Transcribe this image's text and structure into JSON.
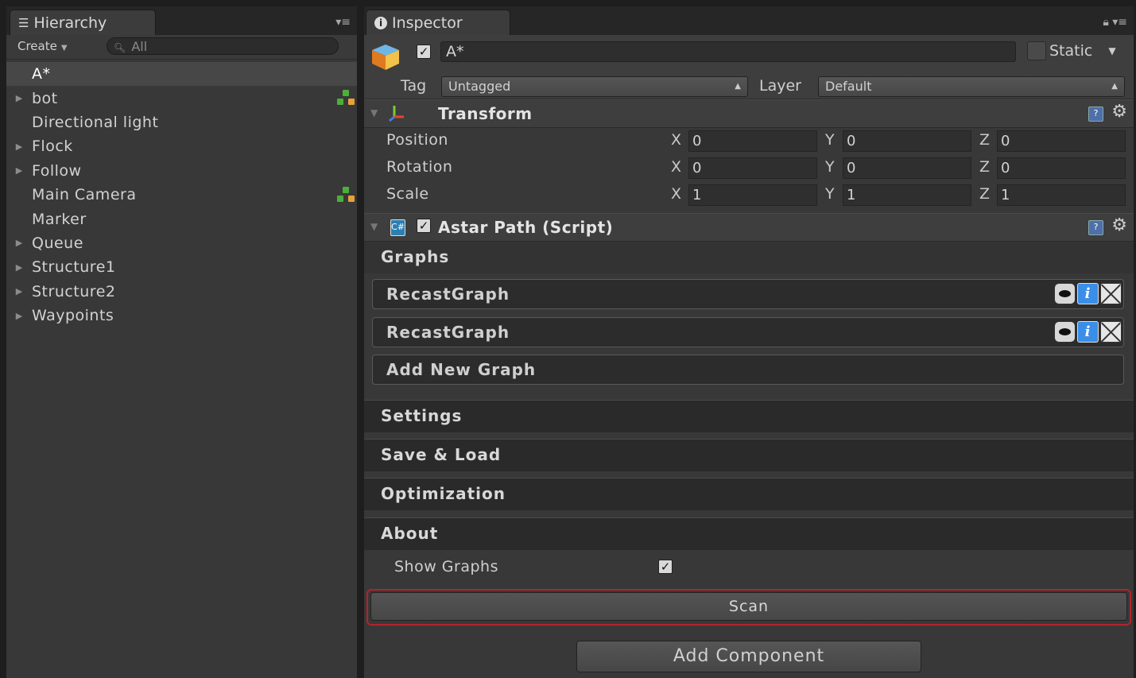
{
  "hierarchy": {
    "tab_label": "Hierarchy",
    "create_label": "Create",
    "search_placeholder": "All",
    "items": [
      {
        "label": "A*",
        "selected": true,
        "expandable": false,
        "prefab": false
      },
      {
        "label": "bot",
        "selected": false,
        "expandable": true,
        "prefab": true
      },
      {
        "label": "Directional light",
        "selected": false,
        "expandable": false,
        "prefab": false
      },
      {
        "label": "Flock",
        "selected": false,
        "expandable": true,
        "prefab": false
      },
      {
        "label": "Follow",
        "selected": false,
        "expandable": true,
        "prefab": false
      },
      {
        "label": "Main Camera",
        "selected": false,
        "expandable": false,
        "prefab": true
      },
      {
        "label": "Marker",
        "selected": false,
        "expandable": false,
        "prefab": false
      },
      {
        "label": "Queue",
        "selected": false,
        "expandable": true,
        "prefab": false
      },
      {
        "label": "Structure1",
        "selected": false,
        "expandable": true,
        "prefab": false
      },
      {
        "label": "Structure2",
        "selected": false,
        "expandable": true,
        "prefab": false
      },
      {
        "label": "Waypoints",
        "selected": false,
        "expandable": true,
        "prefab": false
      }
    ]
  },
  "inspector": {
    "tab_label": "Inspector",
    "object_name": "A*",
    "static_label": "Static",
    "tag_label": "Tag",
    "tag_value": "Untagged",
    "layer_label": "Layer",
    "layer_value": "Default",
    "transform": {
      "title": "Transform",
      "rows": [
        {
          "label": "Position",
          "x": "0",
          "y": "0",
          "z": "0"
        },
        {
          "label": "Rotation",
          "x": "0",
          "y": "0",
          "z": "0"
        },
        {
          "label": "Scale",
          "x": "1",
          "y": "1",
          "z": "1"
        }
      ],
      "axis_x": "X",
      "axis_y": "Y",
      "axis_z": "Z"
    },
    "script": {
      "title": "Astar Path (Script)",
      "graphs_section": "Graphs",
      "graphs": [
        "RecastGraph",
        "RecastGraph"
      ],
      "add_graph_label": "Add New Graph",
      "sections": [
        "Settings",
        "Save & Load",
        "Optimization",
        "About"
      ],
      "show_graphs_label": "Show Graphs",
      "show_graphs_checked": true,
      "scan_label": "Scan"
    },
    "add_component_label": "Add Component"
  }
}
